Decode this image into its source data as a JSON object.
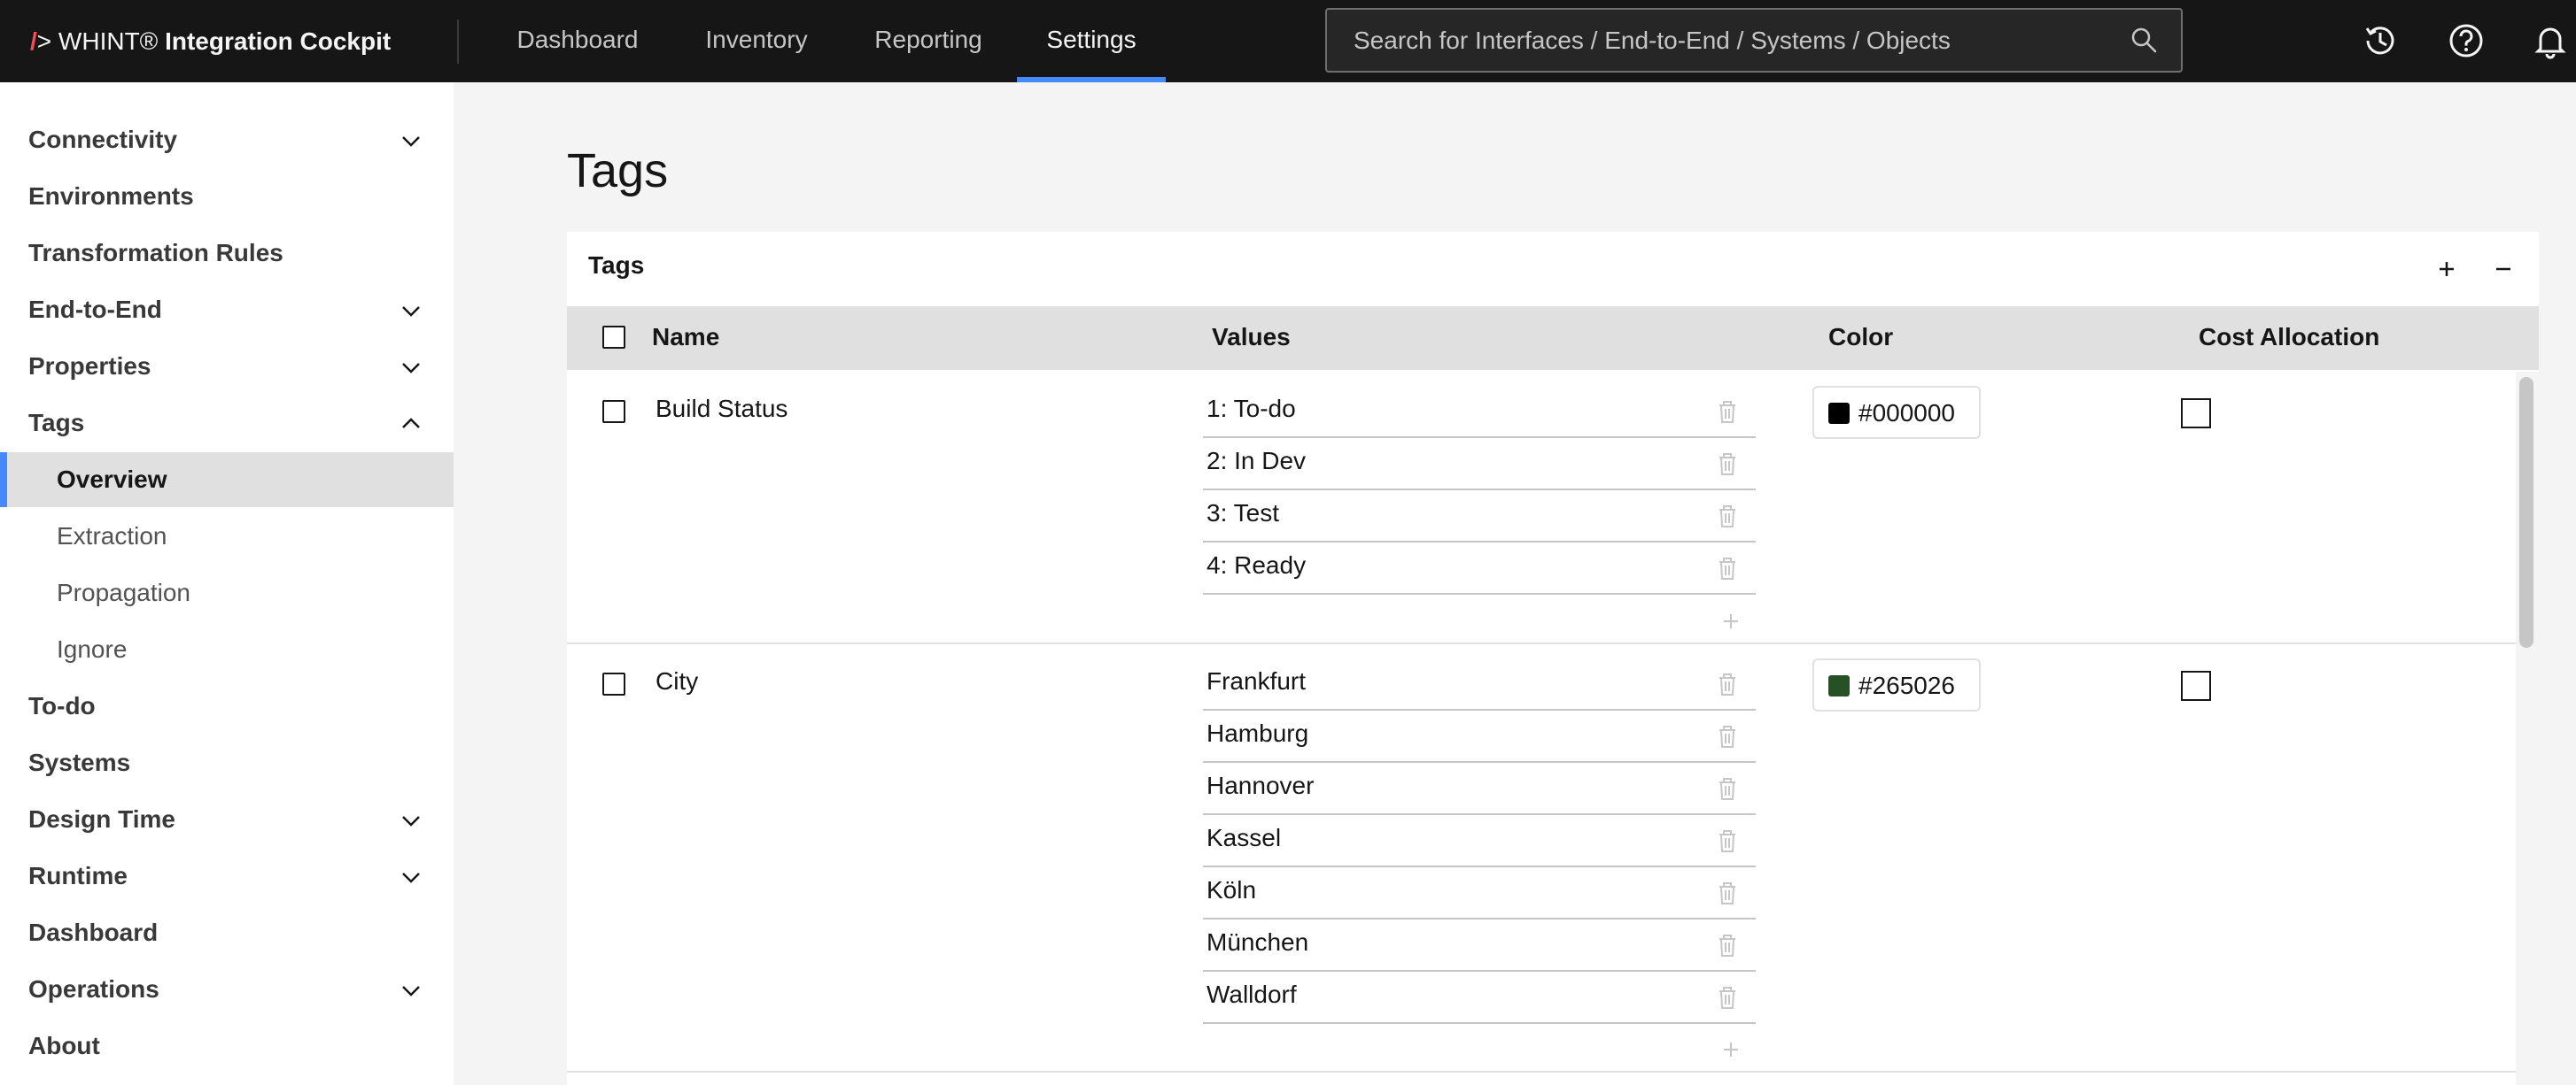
{
  "app": {
    "brand_slash": "/",
    "brand_arrow": ">",
    "brand_name": " WHINT®",
    "brand_product": " Integration Cockpit"
  },
  "nav": {
    "tabs": [
      {
        "label": "Dashboard",
        "active": false
      },
      {
        "label": "Inventory",
        "active": false
      },
      {
        "label": "Reporting",
        "active": false
      },
      {
        "label": "Settings",
        "active": true
      }
    ]
  },
  "search": {
    "placeholder": "Search for Interfaces / End-to-End / Systems / Objects",
    "value": ""
  },
  "header_icons": [
    "history-icon",
    "help-icon",
    "notification-bell-icon"
  ],
  "sidebar": {
    "items": [
      {
        "label": "Connectivity",
        "expandable": true,
        "expanded": false
      },
      {
        "label": "Environments",
        "expandable": false
      },
      {
        "label": "Transformation Rules",
        "expandable": false
      },
      {
        "label": "End-to-End",
        "expandable": true,
        "expanded": false
      },
      {
        "label": "Properties",
        "expandable": true,
        "expanded": false
      },
      {
        "label": "Tags",
        "expandable": true,
        "expanded": true
      },
      {
        "label": "To-do",
        "expandable": false
      },
      {
        "label": "Systems",
        "expandable": false
      },
      {
        "label": "Design Time",
        "expandable": true,
        "expanded": false
      },
      {
        "label": "Runtime",
        "expandable": true,
        "expanded": false
      },
      {
        "label": "Dashboard",
        "expandable": false
      },
      {
        "label": "Operations",
        "expandable": true,
        "expanded": false
      },
      {
        "label": "About",
        "expandable": false
      }
    ],
    "tags_children": [
      {
        "label": "Overview",
        "active": true
      },
      {
        "label": "Extraction",
        "active": false
      },
      {
        "label": "Propagation",
        "active": false
      },
      {
        "label": "Ignore",
        "active": false
      }
    ]
  },
  "main": {
    "page_title": "Tags",
    "card_title": "Tags",
    "add_label": "+",
    "remove_label": "−",
    "columns": {
      "name": "Name",
      "values": "Values",
      "color": "Color",
      "cost_allocation": "Cost Allocation"
    },
    "rows": [
      {
        "name": "Build Status",
        "values": [
          "1: To-do",
          "2: In Dev",
          "3: Test",
          "4: Ready"
        ],
        "color": "#000000",
        "cost_allocation": false
      },
      {
        "name": "City",
        "values": [
          "Frankfurt",
          "Hamburg",
          "Hannover",
          "Kassel",
          "Köln",
          "München",
          "Walldorf"
        ],
        "color": "#265026",
        "cost_allocation": false
      }
    ]
  },
  "colors": {
    "header_bg": "#161616",
    "accent": "#4589ff",
    "brand_slash": "#fa4d56",
    "page_bg": "#f4f4f4",
    "table_header_bg": "#e0e0e0"
  }
}
